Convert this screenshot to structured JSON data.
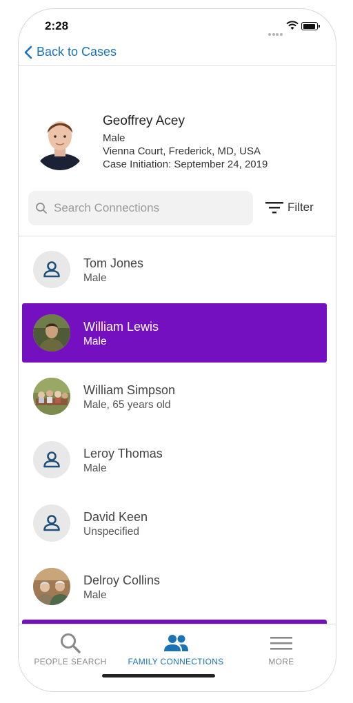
{
  "status": {
    "time": "2:28"
  },
  "nav": {
    "back_label": "Back to Cases"
  },
  "profile": {
    "name": "Geoffrey Acey",
    "gender": "Male",
    "location": "Vienna Court, Frederick, MD, USA",
    "case_initiation": "Case Initiation: September 24, 2019"
  },
  "search": {
    "placeholder": "Search Connections"
  },
  "filter": {
    "label": "Filter"
  },
  "connections": [
    {
      "name": "Tom Jones",
      "detail": "Male",
      "avatar": "person-icon"
    },
    {
      "name": "William Lewis",
      "detail": "Male",
      "avatar": "photo",
      "selected": true
    },
    {
      "name": "William Simpson",
      "detail": "Male, 65 years old",
      "avatar": "photo"
    },
    {
      "name": "Leroy Thomas",
      "detail": "Male",
      "avatar": "person-icon"
    },
    {
      "name": "David Keen",
      "detail": "Unspecified",
      "avatar": "person-icon"
    },
    {
      "name": "Delroy Collins",
      "detail": "Male",
      "avatar": "photo"
    }
  ],
  "tabs": [
    {
      "label": "PEOPLE SEARCH",
      "icon": "search-icon"
    },
    {
      "label": "FAMILY CONNECTIONS",
      "icon": "people-icon",
      "active": true
    },
    {
      "label": "MORE",
      "icon": "menu-icon"
    }
  ],
  "colors": {
    "accent": "#1a73b5",
    "selected_row": "#7510c0",
    "person_icon": "#1e4e79"
  }
}
